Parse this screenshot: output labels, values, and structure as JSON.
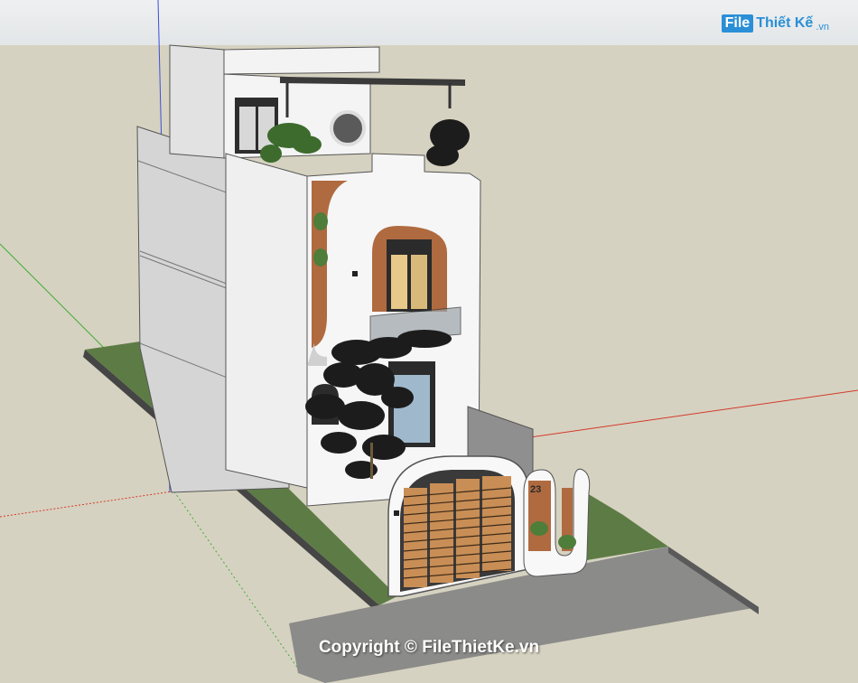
{
  "watermark": {
    "logo_badge": "File",
    "logo_text": "Thiết Kế",
    "logo_suffix": ".vn",
    "copyright": "Copyright © FileThietKe.vn"
  },
  "model": {
    "house_number": "23"
  },
  "colors": {
    "sky": "#eef0f1",
    "ground": "#d6d2c1",
    "lawn": "#5d7c45",
    "sidewalk": "#8a8a88",
    "wall": "#ededed",
    "brick": "#b06a40",
    "axis_red": "#d43a2a",
    "axis_green": "#3fae3a",
    "axis_blue": "#3a4fd6",
    "brand": "#2a8fd6"
  }
}
